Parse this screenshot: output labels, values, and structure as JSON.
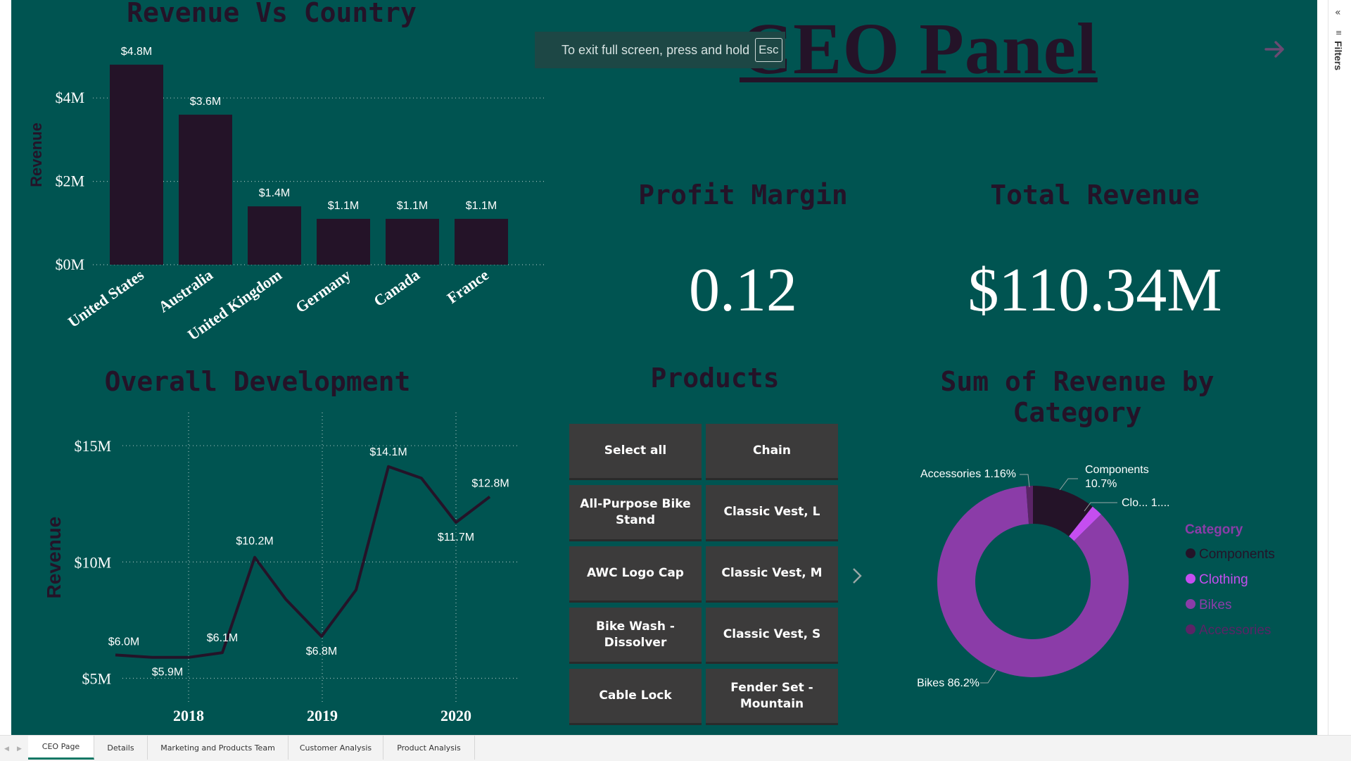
{
  "page": {
    "title": "CEO Panel"
  },
  "toast": {
    "message": "To exit full screen, press and hold",
    "key": "Esc"
  },
  "kpis": [
    {
      "title": "Profit Margin",
      "value": "0.12"
    },
    {
      "title": "Total Revenue",
      "value": "$110.34M"
    }
  ],
  "slicer": {
    "title": "Products",
    "items": [
      "Select all",
      "Chain",
      "All-Purpose Bike Stand",
      "Classic Vest, L",
      "AWC Logo Cap",
      "Classic Vest, M",
      "Bike Wash - Dissolver",
      "Classic Vest, S",
      "Cable Lock",
      "Fender Set - Mountain"
    ]
  },
  "filters_pane": {
    "label": "Filters"
  },
  "tabs": [
    {
      "label": "CEO Page",
      "active": true
    },
    {
      "label": "Details",
      "active": false
    },
    {
      "label": "Marketing and Products Team",
      "active": false
    },
    {
      "label": "Customer Analysis",
      "active": false
    },
    {
      "label": "Product Analysis",
      "active": false
    }
  ],
  "colors": {
    "canvas": "#005451",
    "dark": "#241328",
    "bikes": "#8b3ca8",
    "clothing": "#c54ef0",
    "accessories": "#5a2466"
  },
  "chart_data": [
    {
      "type": "bar",
      "title": "Revenue Vs Country",
      "xlabel": "",
      "ylabel": "Revenue",
      "categories": [
        "United States",
        "Australia",
        "United Kingdom",
        "Germany",
        "Canada",
        "France"
      ],
      "values": [
        4.8,
        3.6,
        1.4,
        1.1,
        1.1,
        1.1
      ],
      "value_labels": [
        "$4.8M",
        "$3.6M",
        "$1.4M",
        "$1.1M",
        "$1.1M",
        "$1.1M"
      ],
      "ylim": [
        0,
        5
      ],
      "yticks": [
        0,
        2,
        4
      ],
      "ytick_labels": [
        "$0M",
        "$2M",
        "$4M"
      ],
      "grid": true
    },
    {
      "type": "line",
      "title": "Overall Development",
      "xlabel": "",
      "ylabel": "Revenue",
      "x": [
        "2017-07",
        "2017-10",
        "2018-01",
        "2018-04",
        "2018-07",
        "2018-10",
        "2019-01",
        "2019-04",
        "2019-07",
        "2019-10",
        "2020-01",
        "2020-04"
      ],
      "values": [
        6.0,
        5.9,
        5.9,
        6.1,
        10.2,
        8.4,
        6.8,
        8.8,
        14.1,
        13.6,
        11.7,
        12.8
      ],
      "point_labels": [
        {
          "index": 0,
          "text": "$6.0M"
        },
        {
          "index": 1,
          "text": "$5.9M"
        },
        {
          "index": 3,
          "text": "$6.1M"
        },
        {
          "index": 4,
          "text": "$10.2M"
        },
        {
          "index": 6,
          "text": "$6.8M"
        },
        {
          "index": 8,
          "text": "$14.1M"
        },
        {
          "index": 10,
          "text": "$11.7M"
        },
        {
          "index": 11,
          "text": "$12.8M"
        }
      ],
      "ylim": [
        4.5,
        16
      ],
      "yticks": [
        5,
        10,
        15
      ],
      "ytick_labels": [
        "$5M",
        "$10M",
        "$15M"
      ],
      "xticks": [
        "2018",
        "2019",
        "2020"
      ],
      "grid": true
    },
    {
      "type": "pie",
      "title": "Sum of Revenue by Category",
      "donut": true,
      "legend_title": "Category",
      "legend": [
        "Components",
        "Clothing",
        "Bikes",
        "Accessories"
      ],
      "slices": [
        {
          "name": "Components",
          "value": 10.7,
          "label": "Components 10.7%",
          "color": "#241328"
        },
        {
          "name": "Clothing",
          "value": 1.9,
          "label": "Clo... 1....",
          "color": "#c54ef0"
        },
        {
          "name": "Bikes",
          "value": 86.2,
          "label": "Bikes 86.2%",
          "color": "#8b3ca8"
        },
        {
          "name": "Accessories",
          "value": 1.16,
          "label": "Accessories 1.16%",
          "color": "#5a2466"
        }
      ],
      "legend_placement": "right"
    }
  ]
}
